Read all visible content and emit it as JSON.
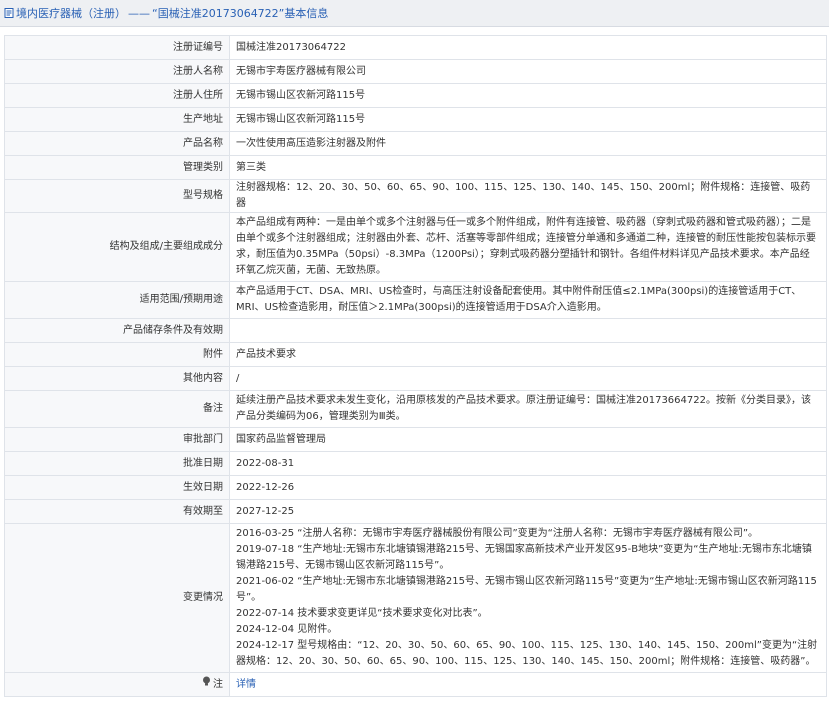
{
  "breadcrumb": {
    "section": "境内医疗器械（注册）",
    "separator": "——",
    "title": "“国械注准20173064722”基本信息"
  },
  "rows": [
    {
      "label": "注册证编号",
      "value": "国械注准20173064722"
    },
    {
      "label": "注册人名称",
      "value": "无锡市宇寿医疗器械有限公司"
    },
    {
      "label": "注册人住所",
      "value": "无锡市锡山区农新河路115号"
    },
    {
      "label": "生产地址",
      "value": "无锡市锡山区农新河路115号"
    },
    {
      "label": "产品名称",
      "value": "一次性使用高压造影注射器及附件"
    },
    {
      "label": "管理类别",
      "value": "第三类"
    },
    {
      "label": "型号规格",
      "value": "注射器规格：12、20、30、50、60、65、90、100、115、125、130、140、145、150、200ml；附件规格：连接管、吸药器"
    },
    {
      "label": "结构及组成/主要组成成分",
      "value": "本产品组成有两种：一是由单个或多个注射器与任一或多个附件组成，附件有连接管、吸药器（穿刺式吸药器和管式吸药器）；二是由单个或多个注射器组成；注射器由外套、芯杆、活塞等零部件组成；连接管分单通和多通道二种，连接管的耐压性能按包装标示要求，耐压值为0.35MPa（50psi）-8.3MPa（1200Psi）；穿刺式吸药器分塑插针和钢针。各组件材料详见产品技术要求。本产品经环氧乙烷灭菌，无菌、无致热原。"
    },
    {
      "label": "适用范围/预期用途",
      "value": "本产品适用于CT、DSA、MRI、US检查时，与高压注射设备配套使用。其中附件耐压值≤2.1MPa(300psi)的连接管适用于CT、MRI、US检查造影用，耐压值＞2.1MPa(300psi)的连接管适用于DSA介入造影用。"
    },
    {
      "label": "产品储存条件及有效期",
      "value": ""
    },
    {
      "label": "附件",
      "value": "产品技术要求"
    },
    {
      "label": "其他内容",
      "value": "/"
    },
    {
      "label": "备注",
      "value": "延续注册产品技术要求未发生变化，沿用原核发的产品技术要求。原注册证编号：国械注准20173664722。按新《分类目录》，该产品分类编码为06，管理类别为Ⅲ类。"
    },
    {
      "label": "审批部门",
      "value": "国家药品监督管理局"
    },
    {
      "label": "批准日期",
      "value": "2022-08-31"
    },
    {
      "label": "生效日期",
      "value": "2022-12-26"
    },
    {
      "label": "有效期至",
      "value": "2027-12-25"
    }
  ],
  "changes": {
    "label": "变更情况",
    "lines": [
      "2016-03-25 “注册人名称：无锡市宇寿医疗器械股份有限公司”变更为“注册人名称：无锡市宇寿医疗器械有限公司”。",
      "2019-07-18 “生产地址:无锡市东北塘镇锡港路215号、无锡国家高新技术产业开发区95-B地块”变更为“生产地址:无锡市东北塘镇锡港路215号、无锡市锡山区农新河路115号”。",
      "2021-06-02 “生产地址:无锡市东北塘镇锡港路215号、无锡市锡山区农新河路115号”变更为“生产地址:无锡市锡山区农新河路115号”。",
      "2022-07-14 技术要求变更详见“技术要求变化对比表”。",
      "2024-12-04 见附件。",
      "2024-12-17 型号规格由：“12、20、30、50、60、65、90、100、115、125、130、140、145、150、200ml”变更为“注射器规格：12、20、30、50、60、65、90、100、115、125、130、140、145、150、200ml；附件规格：连接管、吸药器”。"
    ]
  },
  "note": {
    "label": "注",
    "link_text": "详情",
    "icon": "info-bulb-icon"
  },
  "colors": {
    "link": "#2a61b5",
    "header_bg": "#eef0f3",
    "label_bg": "#f7f8fa",
    "border": "#dfe3e9"
  }
}
